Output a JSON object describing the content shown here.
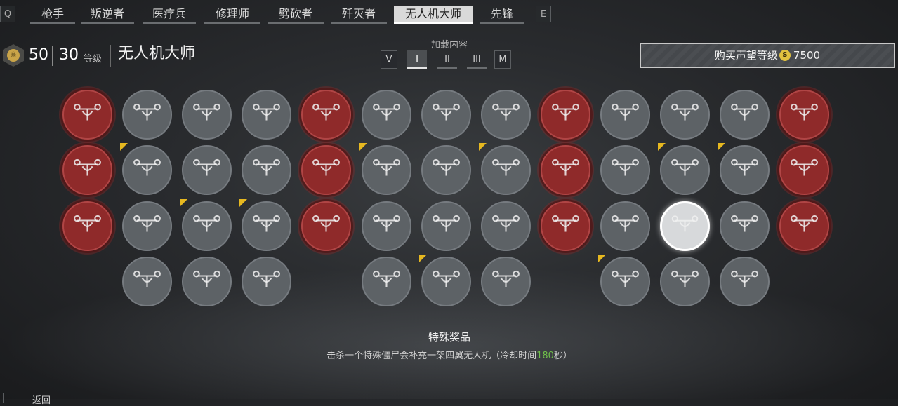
{
  "tabs": {
    "prev_key": "Q",
    "next_key": "E",
    "items": [
      "枪手",
      "叛逆者",
      "医疗兵",
      "修理师",
      "劈砍者",
      "歼灭者",
      "无人机大师",
      "先锋"
    ],
    "active_index": 6
  },
  "header": {
    "badge_icon": "skull-badge-icon",
    "prestige_level": "50",
    "level": "30",
    "level_label": "等级",
    "class_title": "无人机大师"
  },
  "loadout": {
    "title": "加载内容",
    "left_key": "V",
    "right_key": "M",
    "options": [
      "I",
      "II",
      "III"
    ],
    "active_index": 0
  },
  "buy": {
    "label": "购买声望等级",
    "currency_icon": "S",
    "price": "7500"
  },
  "perks": {
    "columns": 13,
    "colors": {
      "red": "#8f2a2a",
      "grey": "#5d6266",
      "selected": "#d7d9db",
      "new_marker": "#e6b820"
    },
    "rows": [
      [
        "red",
        "grey",
        "grey",
        "grey",
        "red",
        "grey",
        "grey",
        "grey",
        "red",
        "grey",
        "grey",
        "grey",
        "red"
      ],
      [
        "red",
        "grey",
        "grey",
        "grey",
        "red",
        "grey",
        "grey",
        "grey",
        "red",
        "grey",
        "grey",
        "grey",
        "red"
      ],
      [
        "red",
        "grey",
        "grey",
        "grey",
        "red",
        "grey",
        "grey",
        "grey",
        "red",
        "grey",
        "sel",
        "grey",
        "red"
      ],
      [
        "",
        "grey",
        "grey",
        "grey",
        "",
        "grey",
        "grey",
        "grey",
        "",
        "grey",
        "grey",
        "grey",
        ""
      ]
    ],
    "new_markers": [
      [
        1,
        1
      ],
      [
        1,
        5
      ],
      [
        1,
        7
      ],
      [
        1,
        10
      ],
      [
        1,
        11
      ],
      [
        2,
        2
      ],
      [
        2,
        3
      ],
      [
        3,
        6
      ],
      [
        3,
        9
      ]
    ]
  },
  "info": {
    "title": "特殊奖品",
    "desc_prefix": "击杀一个特殊僵尸会补充一架四翼无人机（冷却时间",
    "cooldown": "180",
    "desc_suffix": "秒）"
  },
  "footer": {
    "back_label": "返回"
  }
}
